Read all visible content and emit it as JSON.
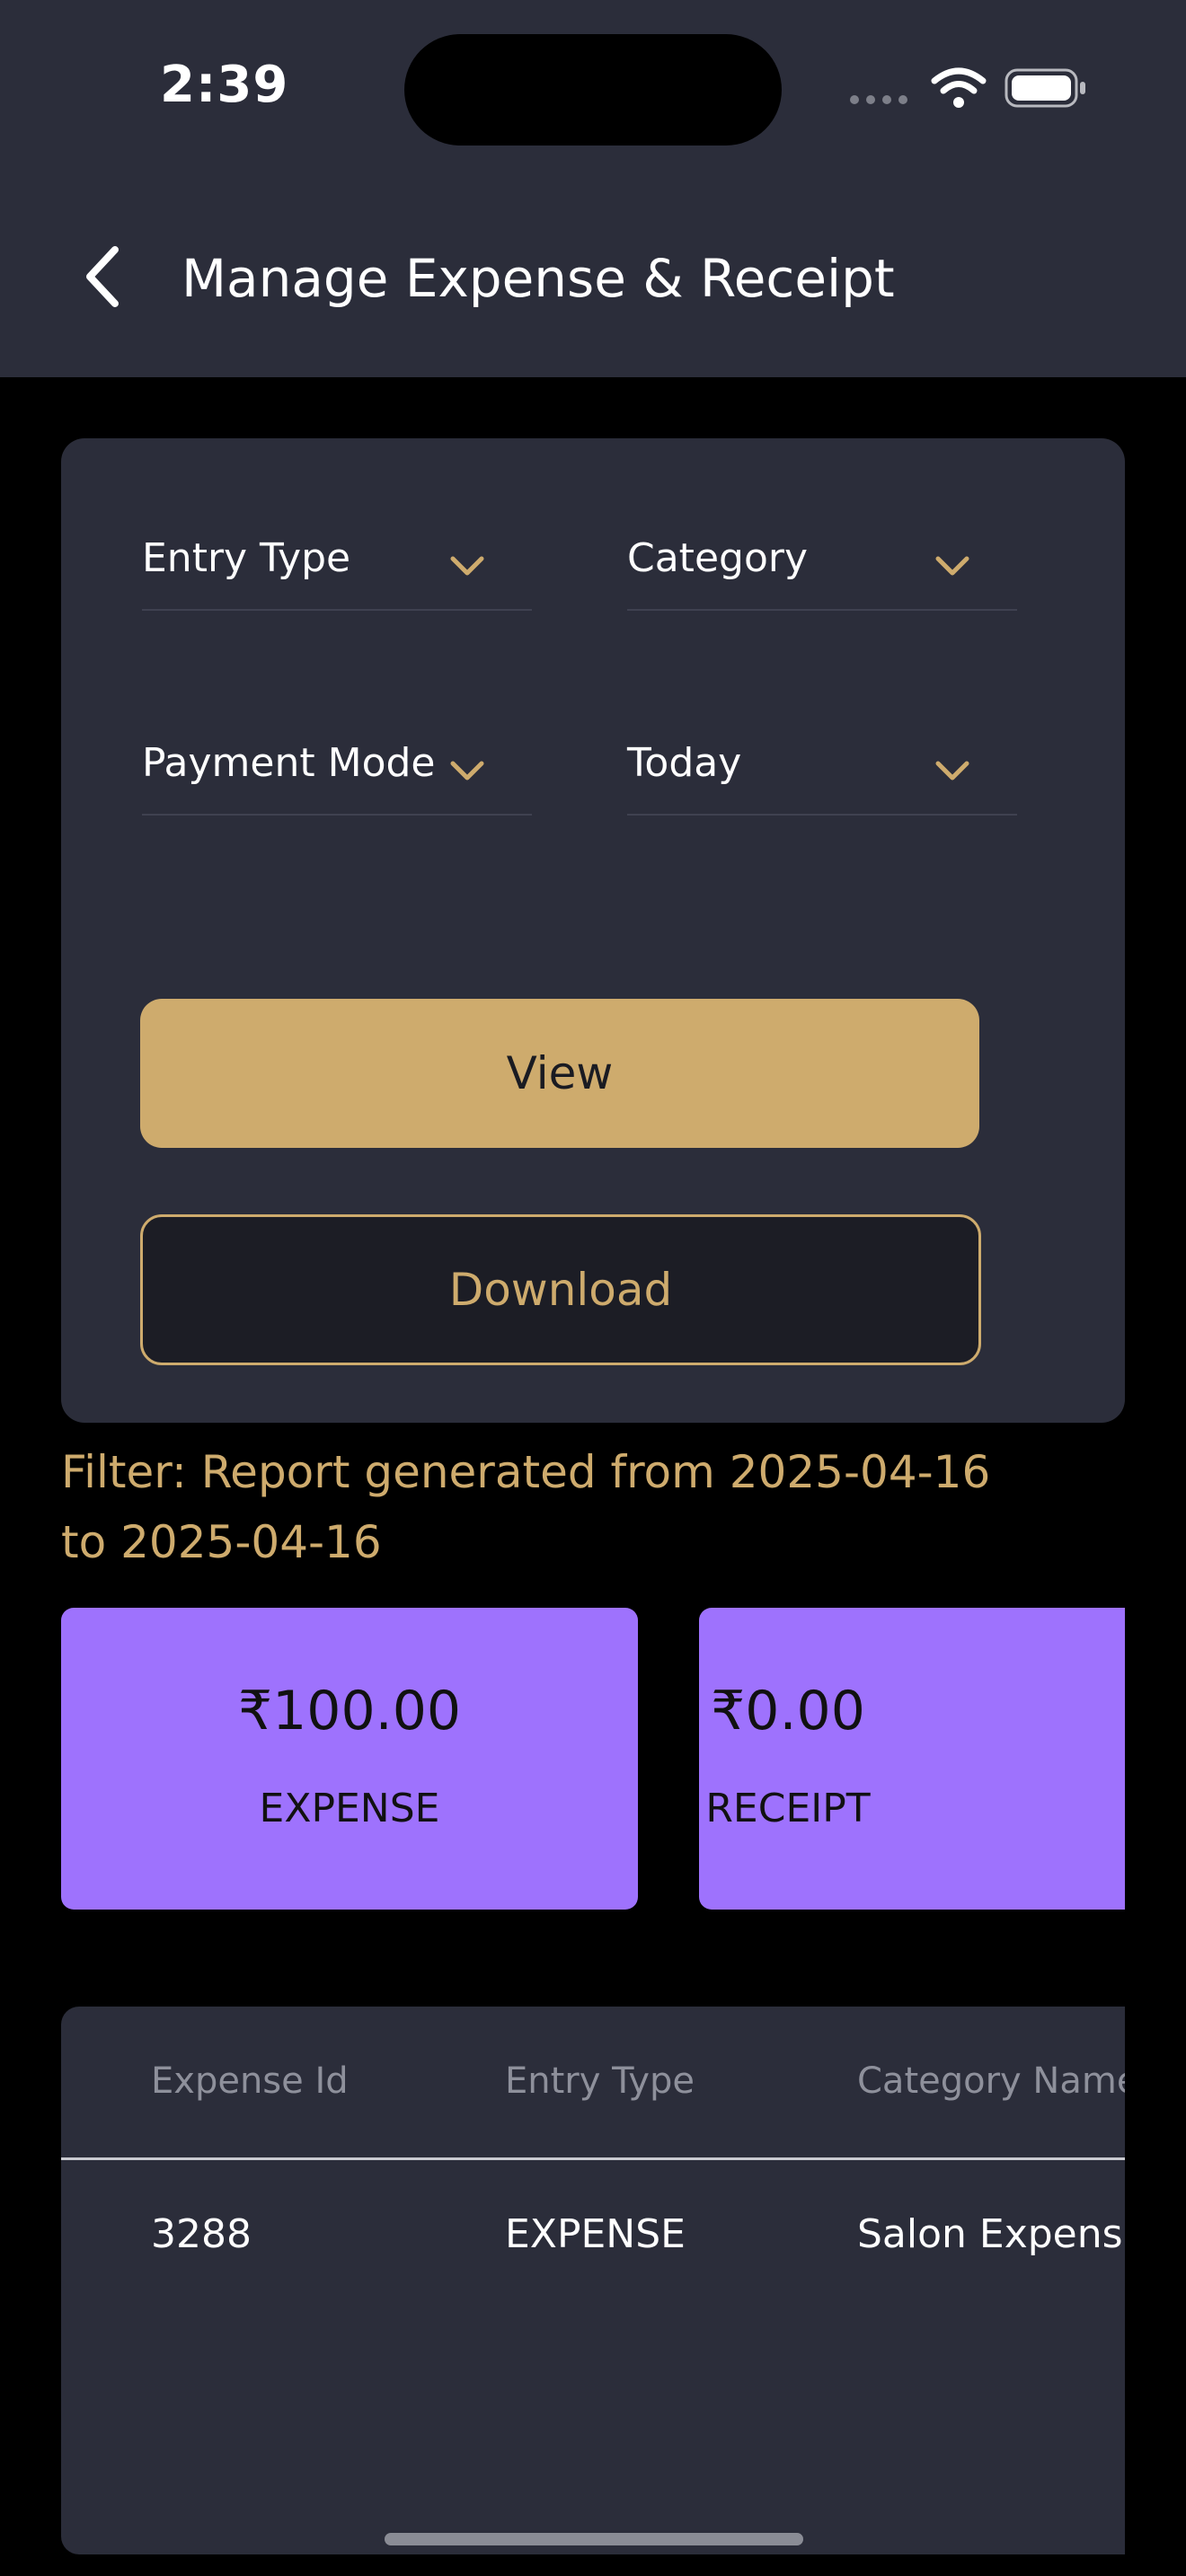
{
  "status_bar": {
    "time": "2:39"
  },
  "header": {
    "title": "Manage Expense & Receipt"
  },
  "filters": {
    "entry_type": "Entry Type",
    "category": "Category",
    "payment_mode": "Payment Mode",
    "date_range": "Today"
  },
  "actions": {
    "view_label": "View",
    "download_label": "Download"
  },
  "report_filter": {
    "line1": "Filter:  Report generated from 2025-04-16",
    "line2": "to  2025-04-16"
  },
  "summary": [
    {
      "amount": "₹100.00",
      "label": "EXPENSE"
    },
    {
      "amount": "₹0.00",
      "label": "RECEIPT"
    }
  ],
  "table": {
    "columns": [
      "Expense Id",
      "Entry Type",
      "Category Name"
    ],
    "rows": [
      [
        "3288",
        "EXPENSE",
        "Salon Expens"
      ]
    ]
  },
  "colors": {
    "accent": "#ceab6d",
    "surface": "#2b2d3a",
    "tile": "#9e72fd",
    "background": "#000000"
  }
}
